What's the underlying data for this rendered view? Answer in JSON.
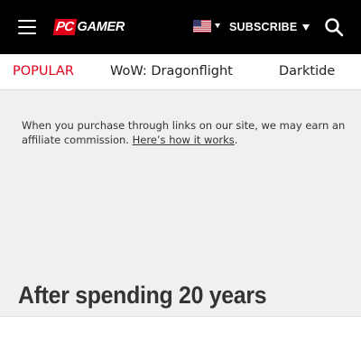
{
  "header": {
    "logo": {
      "pc": "PC",
      "gamer": "GAMER"
    },
    "subscribe_label": "SUBSCRIBE",
    "icons": {
      "menu": "hamburger-menu-icon",
      "flag": "us-flag-icon",
      "search": "search-icon"
    },
    "colors": {
      "bar": "#000000",
      "brand_red": "#e1001a"
    }
  },
  "nav": {
    "items": [
      {
        "label": "POPULAR"
      },
      {
        "label": "WoW: Dragonflight"
      },
      {
        "label": "Darktide"
      }
    ]
  },
  "affiliate": {
    "text": "When you purchase through links on our site, we may earn an affiliate commission. ",
    "link": "Here’s how it works",
    "suffix": "."
  },
  "article": {
    "headline": "After spending 20 years"
  }
}
